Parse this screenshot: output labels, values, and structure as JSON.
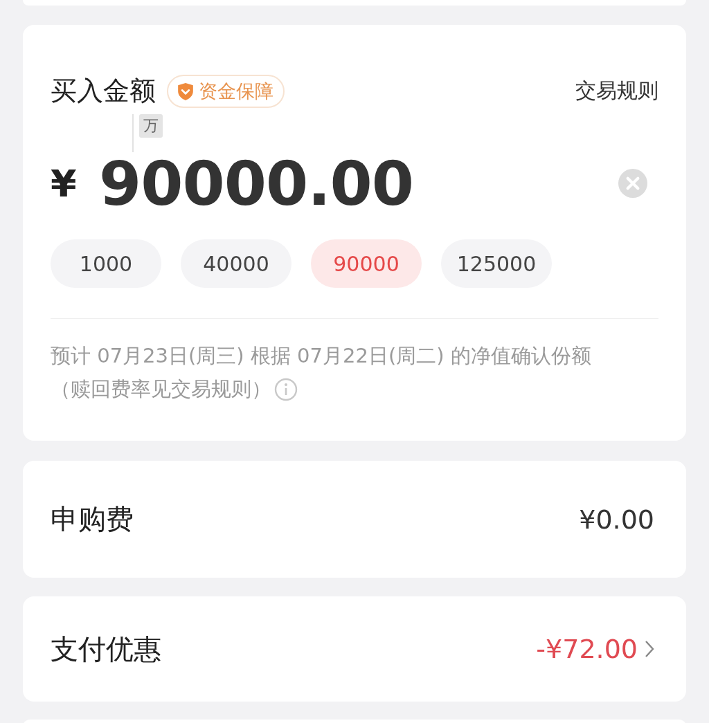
{
  "purchase": {
    "title": "买入金额",
    "badge": "资金保障",
    "rules_link": "交易规则",
    "unit_hint": "万",
    "currency": "¥",
    "amount": "90000.00",
    "presets": [
      {
        "label": "1000",
        "selected": false
      },
      {
        "label": "40000",
        "selected": false
      },
      {
        "label": "90000",
        "selected": true
      },
      {
        "label": "125000",
        "selected": false
      }
    ],
    "note": "预计 07月23日(周三) 根据 07月22日(周二) 的净值确认份额",
    "note_2": "（赎回费率见交易规则）"
  },
  "fee": {
    "label": "申购费",
    "value": "¥0.00"
  },
  "discount": {
    "label": "支付优惠",
    "value": "-¥72.00"
  }
}
